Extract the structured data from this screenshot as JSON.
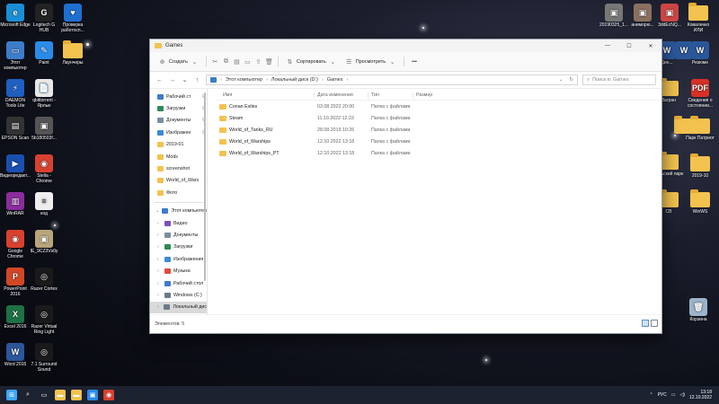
{
  "colors": {
    "folder": "#f3c24f",
    "selection": "#d9d9d9",
    "taskbar": "#1c2230",
    "accent": "#0078d4"
  },
  "desktop": {
    "left_icons": [
      {
        "label": "Microsoft Edge",
        "icon": "edge-icon",
        "color": "#1a8fd6",
        "glyph": "e"
      },
      {
        "label": "Logitech G HUB",
        "icon": "logitech-icon",
        "color": "#222222",
        "glyph": "G"
      },
      {
        "label": "Проверка работосп...",
        "icon": "health-check-icon",
        "color": "#1e6fd0",
        "glyph": "♥"
      },
      {
        "label": "Этот компьютер",
        "icon": "this-pc-icon",
        "color": "#3d7cc9",
        "glyph": "▭"
      },
      {
        "label": "Paint",
        "icon": "paint-icon",
        "color": "#2a8be8",
        "glyph": "✎"
      },
      {
        "label": "Лаунчеры",
        "icon": "folder-icon",
        "color": "",
        "glyph": ""
      },
      {
        "label": "DAEMON Tools Lite",
        "icon": "daemon-tools-icon",
        "color": "#1f5fbf",
        "glyph": "⚡"
      },
      {
        "label": "qbittorrent - Ярлык",
        "icon": "qbittorrent-icon",
        "color": "#e8e8e8",
        "glyph": "📄"
      },
      {
        "label": "EPSON Scan",
        "icon": "epson-scan-icon",
        "color": "#333333",
        "glyph": "▤"
      },
      {
        "label": "5b180503f...",
        "icon": "image-file-icon",
        "color": "#555555",
        "glyph": "▣"
      },
      {
        "label": "Видеоредакт...",
        "icon": "video-editor-icon",
        "color": "#1a4fb0",
        "glyph": "▶"
      },
      {
        "label": "Stella - Chrome",
        "icon": "chrome-icon",
        "color": "#d8412f",
        "glyph": "◉"
      },
      {
        "label": "WinRAR",
        "icon": "winrar-icon",
        "color": "#8b2d9e",
        "glyph": "▥"
      },
      {
        "label": "код",
        "icon": "text-file-icon",
        "color": "#eeeeee",
        "glyph": "≡"
      },
      {
        "label": "Google Chrome",
        "icon": "chrome-icon",
        "color": "#d8412f",
        "glyph": "◉"
      },
      {
        "label": "IE_9CZ3Vs0y",
        "icon": "image-file-icon",
        "color": "#b8a57a",
        "glyph": "▣"
      },
      {
        "label": "PowerPoint 2016",
        "icon": "powerpoint-icon",
        "color": "#d24726",
        "glyph": "P"
      },
      {
        "label": "Razer Cortex",
        "icon": "razer-cortex-icon",
        "color": "#1a1a1a",
        "glyph": "◎"
      },
      {
        "label": "Excel 2016",
        "icon": "excel-icon",
        "color": "#1e7145",
        "glyph": "X"
      },
      {
        "label": "Razer Virtual Ring Light",
        "icon": "razer-ring-light-icon",
        "color": "#1a1a1a",
        "glyph": "◎"
      },
      {
        "label": "Word 2016",
        "icon": "word-icon",
        "color": "#2b579a",
        "glyph": "W"
      },
      {
        "label": "7.1 Surround Sound",
        "icon": "razer-surround-icon",
        "color": "#1a1a1a",
        "glyph": "◎"
      }
    ],
    "right_icons": [
      {
        "label": "20190325_1...",
        "icon": "image-file-icon",
        "color": "#777777",
        "glyph": "▣"
      },
      {
        "label": "аниморю...",
        "icon": "image-file-icon",
        "color": "#8a7060",
        "glyph": "▣"
      },
      {
        "label": "3ddEcNQ...",
        "icon": "image-file-icon",
        "color": "#c44",
        "glyph": "▣"
      },
      {
        "label": "Коваленко ИЛИ",
        "icon": "folder-icon",
        "color": "",
        "glyph": ""
      },
      {
        "label": "Дин...",
        "icon": "word-file-icon",
        "color": "#2b579a",
        "glyph": "W"
      },
      {
        "label": "",
        "icon": "word-file-icon",
        "color": "#2b579a",
        "glyph": "W"
      },
      {
        "label": "Резюме",
        "icon": "word-file-icon",
        "color": "#2b579a",
        "glyph": "W"
      },
      {
        "label": "Загран",
        "icon": "folder-icon",
        "color": "",
        "glyph": ""
      },
      {
        "label": "",
        "icon": "folder-icon",
        "color": "",
        "glyph": ""
      },
      {
        "label": "Сведения о состоянии...",
        "icon": "pdf-icon",
        "color": "#d93025",
        "glyph": "PDF"
      },
      {
        "label": "Парк Патриот",
        "icon": "folder-icon",
        "color": "",
        "glyph": ""
      },
      {
        "label": "",
        "icon": "folder-icon",
        "color": "",
        "glyph": ""
      },
      {
        "label": "кольский парк",
        "icon": "folder-icon",
        "color": "",
        "glyph": ""
      },
      {
        "label": "2019-10",
        "icon": "folder-icon",
        "color": "",
        "glyph": ""
      },
      {
        "label": "СВ",
        "icon": "folder-icon",
        "color": "",
        "glyph": ""
      },
      {
        "label": "WinWS",
        "icon": "folder-icon",
        "color": "",
        "glyph": ""
      },
      {
        "label": "Корзина",
        "icon": "recycle-bin-icon",
        "color": "#9bb4cc",
        "glyph": "🗑"
      }
    ]
  },
  "explorer": {
    "title": "Games",
    "toolbar": {
      "create_label": "Создать",
      "sort_label": "Сортировать",
      "view_label": "Просмотреть",
      "more_label": "•••"
    },
    "address": {
      "parts": [
        "Этот компьютер",
        "Локальный диск (D:)",
        "Games"
      ],
      "search_placeholder": "Поиск в: Games"
    },
    "nav_pinned": [
      {
        "label": "Рабочий ст",
        "icon": "desktop-icon",
        "color": "#3d7cc9",
        "pinned": true
      },
      {
        "label": "Загрузки",
        "icon": "downloads-icon",
        "color": "#2e8b57",
        "pinned": true
      },
      {
        "label": "Документы",
        "icon": "documents-icon",
        "color": "#7a8da3",
        "pinned": true
      },
      {
        "label": "Изображен",
        "icon": "pictures-icon",
        "color": "#3c8ad8",
        "pinned": true
      },
      {
        "label": "2019-01",
        "icon": "folder-icon",
        "color": "#f3c24f",
        "pinned": false
      },
      {
        "label": "Mods",
        "icon": "folder-icon",
        "color": "#f3c24f",
        "pinned": false
      },
      {
        "label": "screenshot",
        "icon": "folder-icon",
        "color": "#f3c24f",
        "pinned": false
      },
      {
        "label": "World_of_Wars",
        "icon": "folder-icon",
        "color": "#f3c24f",
        "pinned": false
      },
      {
        "label": "Фото",
        "icon": "folder-icon",
        "color": "#f3c24f",
        "pinned": false
      }
    ],
    "nav_pc": {
      "label": "Этот компьютер",
      "icon": "this-pc-icon"
    },
    "nav_pc_items": [
      {
        "label": "Видео",
        "icon": "videos-icon",
        "color": "#7b4fbf",
        "selected": false
      },
      {
        "label": "Документы",
        "icon": "documents-icon",
        "color": "#7a8da3",
        "selected": false
      },
      {
        "label": "Загрузки",
        "icon": "downloads-icon",
        "color": "#2e8b57",
        "selected": false
      },
      {
        "label": "Изображения",
        "icon": "pictures-icon",
        "color": "#3c8ad8",
        "selected": false
      },
      {
        "label": "Музыка",
        "icon": "music-icon",
        "color": "#e04a3c",
        "selected": false
      },
      {
        "label": "Рабочий стол",
        "icon": "desktop-icon",
        "color": "#3d7cc9",
        "selected": false
      },
      {
        "label": "Windows (C:)",
        "icon": "drive-icon",
        "color": "#6d7a88",
        "selected": false
      },
      {
        "label": "Локальный дис",
        "icon": "drive-icon",
        "color": "#6d7a88",
        "selected": true
      },
      {
        "label": "Новый том (E:",
        "icon": "drive-icon",
        "color": "#6d7a88",
        "selected": false
      }
    ],
    "columns": {
      "name": "Имя",
      "date": "Дата изменения",
      "type": "Тип",
      "size": "Размер"
    },
    "files": [
      {
        "name": "Conan Exiles",
        "date": "03.08.2022 20:00",
        "type": "Папка с файлами",
        "size": ""
      },
      {
        "name": "Steam",
        "date": "11.10.2022 12:23",
        "type": "Папка с файлами",
        "size": ""
      },
      {
        "name": "World_of_Tanks_RU",
        "date": "28.08.2019 10:26",
        "type": "Папка с файлами",
        "size": ""
      },
      {
        "name": "World_of_Warships",
        "date": "12.10.2022 13:18",
        "type": "Папка с файлами",
        "size": ""
      },
      {
        "name": "World_of_Warships_PT",
        "date": "12.10.2022 13:18",
        "type": "Папка с файлами",
        "size": ""
      }
    ],
    "status": "Элементов: 5"
  },
  "taskbar": {
    "apps": [
      {
        "icon": "start-icon",
        "color": "#3ea6ff",
        "glyph": "⊞"
      },
      {
        "icon": "search-icon",
        "color": "transparent",
        "glyph": "⌕"
      },
      {
        "icon": "task-view-icon",
        "color": "transparent",
        "glyph": "▭"
      },
      {
        "icon": "file-explorer-icon",
        "color": "#f3c24f",
        "glyph": "▬"
      },
      {
        "icon": "folder-icon",
        "color": "#f3c24f",
        "glyph": "▬"
      },
      {
        "icon": "photos-icon",
        "color": "#2a8be8",
        "glyph": "▣"
      },
      {
        "icon": "chrome-icon",
        "color": "#d8412f",
        "glyph": "◉"
      }
    ],
    "lang": "РУС",
    "time": "13:18",
    "date": "12.10.2022"
  }
}
